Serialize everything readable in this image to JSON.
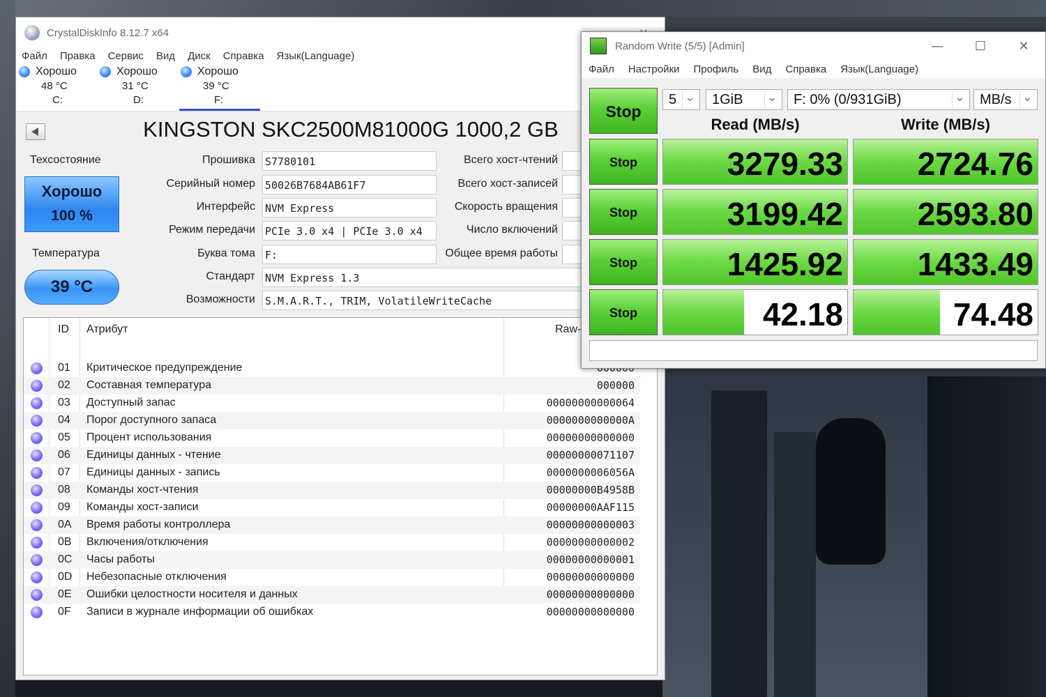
{
  "crystaldiskinfo": {
    "title": "CrystalDiskInfo 8.12.7 x64",
    "title_buttons": [
      "—",
      "✕"
    ],
    "menu": [
      "Файл",
      "Правка",
      "Сервис",
      "Вид",
      "Диск",
      "Справка",
      "Язык(Language)"
    ],
    "disks": [
      {
        "status": "Хорошо",
        "temp": "48 °C",
        "letter": "C:"
      },
      {
        "status": "Хорошо",
        "temp": "31 °C",
        "letter": "D:"
      },
      {
        "status": "Хорошо",
        "temp": "39 °C",
        "letter": "F:"
      }
    ],
    "drive_title": "KINGSTON SKC2500M81000G 1000,2 GB",
    "health_label": "Техсостояние",
    "health_status": "Хорошо",
    "health_percent": "100 %",
    "temperature_label": "Температура",
    "temperature_value": "39 °C",
    "fields": [
      {
        "label": "Прошивка",
        "value": "S7780101"
      },
      {
        "label": "Серийный номер",
        "value": "50026B7684AB61F7"
      },
      {
        "label": "Интерфейс",
        "value": "NVM Express"
      },
      {
        "label": "Режим передачи",
        "value": "PCIe 3.0 x4 | PCIe 3.0 x4"
      },
      {
        "label": "Буква тома",
        "value": "F:"
      },
      {
        "label": "Стандарт",
        "value": "NVM Express 1.3"
      },
      {
        "label": "Возможности",
        "value": "S.M.A.R.T., TRIM, VolatileWriteCache"
      }
    ],
    "right_labels": [
      "Всего хост-чтений",
      "Всего хост-записей",
      "Скорость вращения",
      "Число включений",
      "Общее время работы"
    ],
    "smart_headers": {
      "id": "ID",
      "attribute": "Атрибут",
      "raw": "Raw-"
    },
    "smart_rows": [
      {
        "id": "01",
        "attr": "Критическое предупреждение",
        "raw": "000000"
      },
      {
        "id": "02",
        "attr": "Составная температура",
        "raw": "000000"
      },
      {
        "id": "03",
        "attr": "Доступный запас",
        "raw": "00000000000064"
      },
      {
        "id": "04",
        "attr": "Порог доступного запаса",
        "raw": "0000000000000A"
      },
      {
        "id": "05",
        "attr": "Процент использования",
        "raw": "00000000000000"
      },
      {
        "id": "06",
        "attr": "Единицы данных - чтение",
        "raw": "00000000071107"
      },
      {
        "id": "07",
        "attr": "Единицы данных - запись",
        "raw": "0000000006056A"
      },
      {
        "id": "08",
        "attr": "Команды хост-чтения",
        "raw": "00000000B4958B"
      },
      {
        "id": "09",
        "attr": "Команды хост-записи",
        "raw": "00000000AAF115"
      },
      {
        "id": "0A",
        "attr": "Время работы контроллера",
        "raw": "00000000000003"
      },
      {
        "id": "0B",
        "attr": "Включения/отключения",
        "raw": "00000000000002"
      },
      {
        "id": "0C",
        "attr": "Часы работы",
        "raw": "00000000000001"
      },
      {
        "id": "0D",
        "attr": "Небезопасные отключения",
        "raw": "00000000000000"
      },
      {
        "id": "0E",
        "attr": "Ошибки целостности носителя и данных",
        "raw": "00000000000000"
      },
      {
        "id": "0F",
        "attr": "Записи в журнале информации об ошибках",
        "raw": "00000000000000"
      }
    ]
  },
  "crystaldiskmark": {
    "title": "Random Write (5/5) [Admin]",
    "title_buttons": [
      "—",
      "☐",
      "✕"
    ],
    "menu": [
      "Файл",
      "Настройки",
      "Профиль",
      "Вид",
      "Справка",
      "Язык(Language)"
    ],
    "main_button": "Stop",
    "count": "5",
    "size": "1GiB",
    "drive": "F: 0% (0/931GiB)",
    "unit": "MB/s",
    "read_header": "Read (MB/s)",
    "write_header": "Write (MB/s)",
    "rows": [
      {
        "button": "Stop",
        "read": "3279.33",
        "write": "2724.76",
        "read_level": 1.0,
        "write_level": 1.0
      },
      {
        "button": "Stop",
        "read": "3199.42",
        "write": "2593.80",
        "read_level": 1.0,
        "write_level": 1.0
      },
      {
        "button": "Stop",
        "read": "1425.92",
        "write": "1433.49",
        "read_level": 1.0,
        "write_level": 1.0
      },
      {
        "button": "Stop",
        "read": "42.18",
        "write": "74.48",
        "read_level": 0.44,
        "write_level": 0.47
      }
    ],
    "comment": "",
    "accent_green": "#52c42c"
  }
}
